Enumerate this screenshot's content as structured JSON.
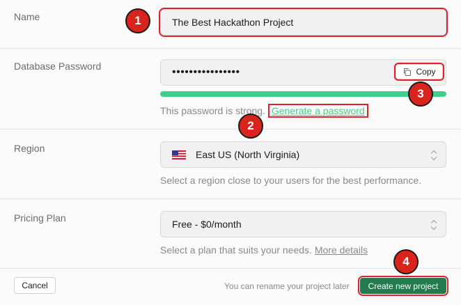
{
  "name_row": {
    "label": "Name",
    "value": "The Best Hackathon Project"
  },
  "password_row": {
    "label": "Database Password",
    "value": "••••••••••••••••",
    "copy_label": "Copy",
    "strength": 1.0,
    "strength_color": "#3ecf8e",
    "help_text": "This password is strong.",
    "generate_link": "Generate a password"
  },
  "region_row": {
    "label": "Region",
    "value": "East US (North Virginia)",
    "flag_icon": "us-flag-icon",
    "help_text": "Select a region close to your users for the best performance."
  },
  "pricing_row": {
    "label": "Pricing Plan",
    "value": "Free - $0/month",
    "help_text": "Select a plan that suits your needs.",
    "more_link": "More details"
  },
  "footer": {
    "cancel_label": "Cancel",
    "rename_note": "You can rename your project later",
    "create_label": "Create new project"
  },
  "annotations": [
    "1",
    "2",
    "3",
    "4"
  ],
  "colors": {
    "accent": "#3ecf8e",
    "primary_button": "#227a4f",
    "highlight": "#e0212b"
  }
}
